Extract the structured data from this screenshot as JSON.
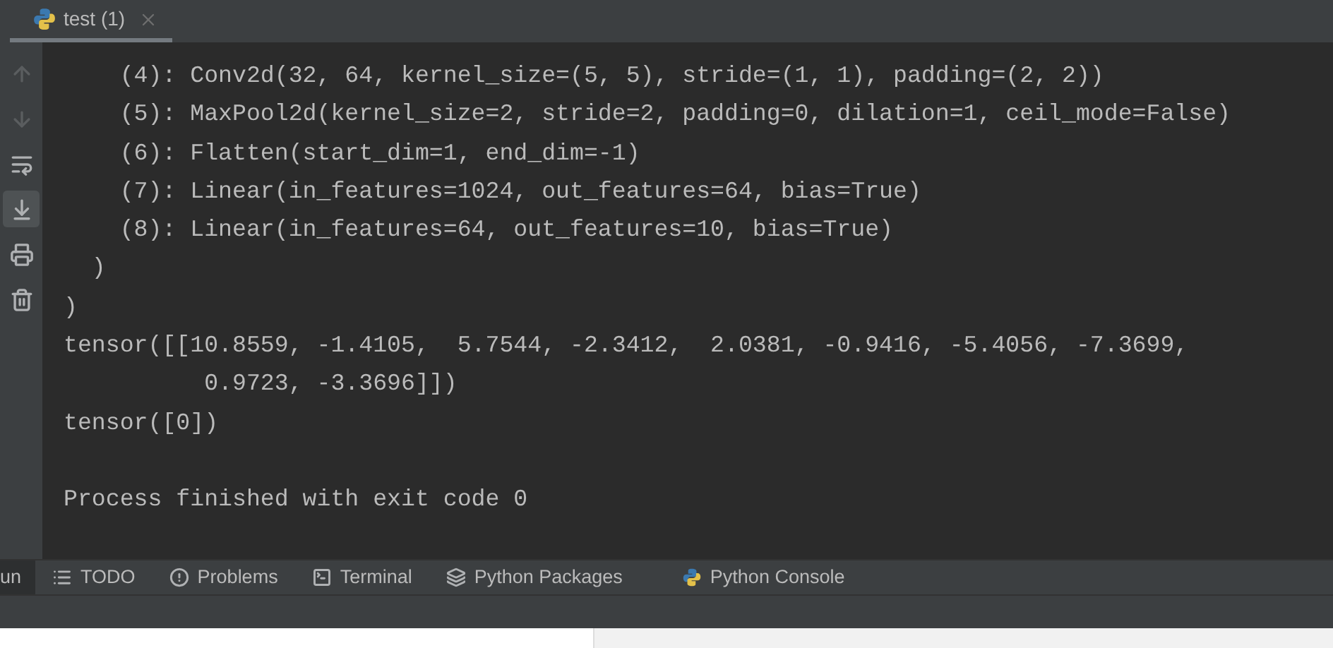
{
  "tab": {
    "title": "test (1)",
    "selected": true
  },
  "toolbar": [
    {
      "disabled": true,
      "active": false
    },
    {
      "disabled": true,
      "active": false
    },
    {
      "disabled": false,
      "active": false
    },
    {
      "disabled": false,
      "active": true
    },
    {
      "disabled": false,
      "active": false
    },
    {
      "disabled": false,
      "active": false
    }
  ],
  "console_lines": [
    "    (4): Conv2d(32, 64, kernel_size=(5, 5), stride=(1, 1), padding=(2, 2))",
    "    (5): MaxPool2d(kernel_size=2, stride=2, padding=0, dilation=1, ceil_mode=False)",
    "    (6): Flatten(start_dim=1, end_dim=-1)",
    "    (7): Linear(in_features=1024, out_features=64, bias=True)",
    "    (8): Linear(in_features=64, out_features=10, bias=True)",
    "  )",
    ")",
    "tensor([[10.8559, -1.4105,  5.7544, -2.3412,  2.0381, -0.9416, -5.4056, -7.3699,",
    "          0.9723, -3.3696]])",
    "tensor([0])"
  ],
  "exit_message": "Process finished with exit code 0",
  "tool_windows": [
    {
      "label": "un",
      "selected": true
    },
    {
      "label": "TODO",
      "selected": false
    },
    {
      "label": "Problems",
      "selected": false
    },
    {
      "label": "Terminal",
      "selected": false
    },
    {
      "label": "Python Packages",
      "selected": false
    },
    {
      "label": "Python Console",
      "selected": false
    }
  ]
}
